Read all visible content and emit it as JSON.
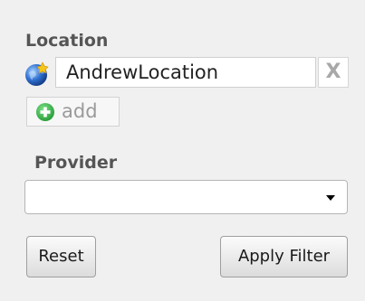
{
  "location": {
    "label": "Location",
    "value": "AndrewLocation",
    "remove_label": "X",
    "add_label": "add",
    "icon": "globe-icon"
  },
  "provider": {
    "label": "Provider",
    "selected": ""
  },
  "actions": {
    "reset_label": "Reset",
    "apply_label": "Apply Filter"
  },
  "colors": {
    "panel_background": "#f0f0f0",
    "label_text": "#555555",
    "add_icon_green": "#3aa64a"
  }
}
